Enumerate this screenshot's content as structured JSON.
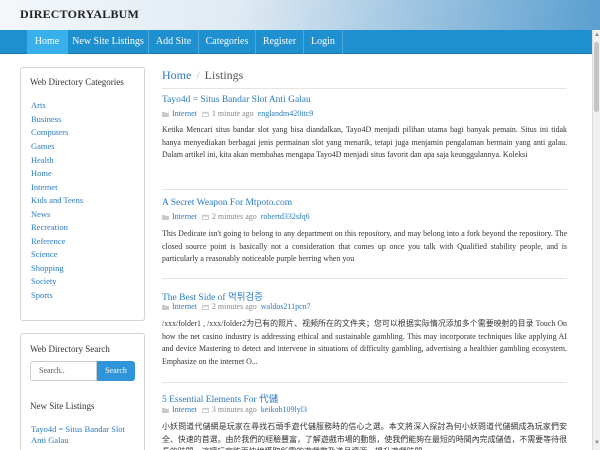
{
  "header": {
    "brand": "DIRECTORYALBUM"
  },
  "nav": {
    "items": [
      {
        "label": "Home",
        "active": true
      },
      {
        "label": "New Site Listings"
      },
      {
        "label": "Add Site"
      },
      {
        "label": "Categories"
      },
      {
        "label": "Register"
      },
      {
        "label": "Login"
      }
    ]
  },
  "sidebar": {
    "categories_title": "Web Directory Categories",
    "categories": [
      "Arts",
      "Business",
      "Computers",
      "Games",
      "Health",
      "Home",
      "Internet",
      "Kids and Teens",
      "News",
      "Recreation",
      "Reference",
      "Science",
      "Shopping",
      "Society",
      "Sports"
    ],
    "search_title": "Web Directory Search",
    "search_placeholder": "Search..",
    "search_button": "Search",
    "new_sites_title": "New Site Listings",
    "new_sites": [
      "Tayo4d = Situs Bandar Slot Anti Galau"
    ]
  },
  "breadcrumb": {
    "home": "Home",
    "separator": "/",
    "current": "Listings"
  },
  "listings": [
    {
      "title": "Tayo4d = Situs Bandar Slot Anti Galau",
      "category": "Internet",
      "time": "1 minute ago",
      "user": "englandm420itc9",
      "description": "Ketika Mencari situs bandar slot yang bisa diandalkan, Tayo4D menjadi pilihan utama bagi banyak pemain. Situs ini tidak hanya menyediakan berbagai jenis permainan slot yang menarik, tetapi juga menjamin pengalaman bermain yang anti galau. Dalam artikel ini, kita akan membahas mengapa Tayo4D menjadi situs favorit dan apa saja keunggulannya. Koleksi"
    },
    {
      "title": "A Secret Weapon For Mtpoto.com",
      "category": "Internet",
      "time": "2 minutes ago",
      "user": "robertd332sfq6",
      "description": "This Dedicate isn't going to belong to any department on this repository, and may belong into a fork beyond the repository. The closed source point is basically not a consideration that comes up once you talk with Qualified stability people, and is particularly a reasonably noticeable purple herring when you"
    },
    {
      "title": "The Best Side of 먹튀검증",
      "category": "Internet",
      "time": "2 minutes ago",
      "user": "waldos211pcn7",
      "description": "/xxx/folder1 , /xxx/folder2为已有的照片、视频所在的文件夹；您可以根据实际情况添加多个需要映射的目录 Touch On how the net casino industry is addressing ethical and sustainable gambling. This may incorporate techniques like applying AI and device Mastering to detect and intervene in situations of difficulty gambling, advertising a healthier gambling ecosystem. Emphasize on the internet O..."
    },
    {
      "title": "5 Essential Elements For 代儲",
      "category": "Internet",
      "time": "3 minutes ago",
      "user": "keikob109lyl3",
      "description": "小妖問道代儲網是玩家在尋找石頭手遊代儲服務時的信心之選。本文將深入探討為何小妖問道代儲網成為玩家們安全、快速的首選。由於我們的經驗豐富，了解遊戲市場的動態，使我們能夠在最短的時間內完成儲值，不需要等待很長的時間。這讓玩家能更快地獲取所需的遊戲幣及道具資源，提升遊戲時間"
    }
  ],
  "colors": {
    "nav_bg": "#1e8fcf",
    "nav_active": "#37b0ec",
    "link": "#2a7ac0",
    "search_button": "#2f94d8"
  }
}
